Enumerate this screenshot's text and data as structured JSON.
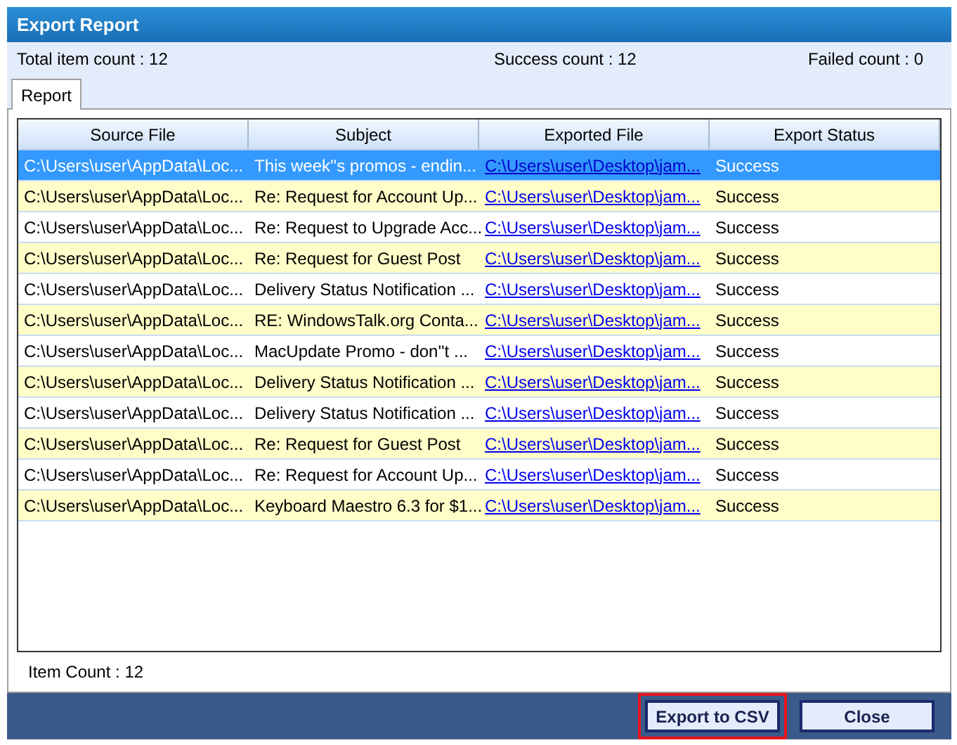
{
  "window": {
    "title": "Export Report"
  },
  "summary": {
    "total": "Total item count : 12",
    "success": "Success count :  12",
    "failed": "Failed count : 0"
  },
  "tabs": [
    {
      "label": "Report",
      "selected": true
    }
  ],
  "table": {
    "columns": [
      "Source File",
      "Subject",
      "Exported File",
      "Export Status"
    ],
    "rows": [
      {
        "source": "C:\\Users\\user\\AppData\\Loc...",
        "subject": "This week''s promos - endin...",
        "exported": "C:\\Users\\user\\Desktop\\jam...",
        "status": "Success",
        "selected": true
      },
      {
        "source": "C:\\Users\\user\\AppData\\Loc...",
        "subject": "Re: Request for Account Up...",
        "exported": "C:\\Users\\user\\Desktop\\jam...",
        "status": "Success",
        "selected": false
      },
      {
        "source": "C:\\Users\\user\\AppData\\Loc...",
        "subject": "Re: Request to Upgrade Acc...",
        "exported": "C:\\Users\\user\\Desktop\\jam...",
        "status": "Success",
        "selected": false
      },
      {
        "source": "C:\\Users\\user\\AppData\\Loc...",
        "subject": "Re: Request for Guest Post",
        "exported": "C:\\Users\\user\\Desktop\\jam...",
        "status": "Success",
        "selected": false
      },
      {
        "source": "C:\\Users\\user\\AppData\\Loc...",
        "subject": "Delivery Status Notification ...",
        "exported": "C:\\Users\\user\\Desktop\\jam...",
        "status": "Success",
        "selected": false
      },
      {
        "source": "C:\\Users\\user\\AppData\\Loc...",
        "subject": "RE: WindowsTalk.org Conta...",
        "exported": "C:\\Users\\user\\Desktop\\jam...",
        "status": "Success",
        "selected": false
      },
      {
        "source": "C:\\Users\\user\\AppData\\Loc...",
        "subject": "MacUpdate Promo - don''t ...",
        "exported": "C:\\Users\\user\\Desktop\\jam...",
        "status": "Success",
        "selected": false
      },
      {
        "source": "C:\\Users\\user\\AppData\\Loc...",
        "subject": "Delivery Status Notification ...",
        "exported": "C:\\Users\\user\\Desktop\\jam...",
        "status": "Success",
        "selected": false
      },
      {
        "source": "C:\\Users\\user\\AppData\\Loc...",
        "subject": "Delivery Status Notification ...",
        "exported": "C:\\Users\\user\\Desktop\\jam...",
        "status": "Success",
        "selected": false
      },
      {
        "source": "C:\\Users\\user\\AppData\\Loc...",
        "subject": "Re: Request for Guest Post",
        "exported": "C:\\Users\\user\\Desktop\\jam...",
        "status": "Success",
        "selected": false
      },
      {
        "source": "C:\\Users\\user\\AppData\\Loc...",
        "subject": "Re: Request for Account Up...",
        "exported": "C:\\Users\\user\\Desktop\\jam...",
        "status": "Success",
        "selected": false
      },
      {
        "source": "C:\\Users\\user\\AppData\\Loc...",
        "subject": "Keyboard Maestro 6.3 for $1...",
        "exported": "C:\\Users\\user\\Desktop\\jam...",
        "status": "Success",
        "selected": false
      }
    ]
  },
  "item_count": "Item Count : 12",
  "buttons": [
    {
      "label": "Export to CSV",
      "highlighted": true
    },
    {
      "label": "Close",
      "highlighted": false
    }
  ]
}
